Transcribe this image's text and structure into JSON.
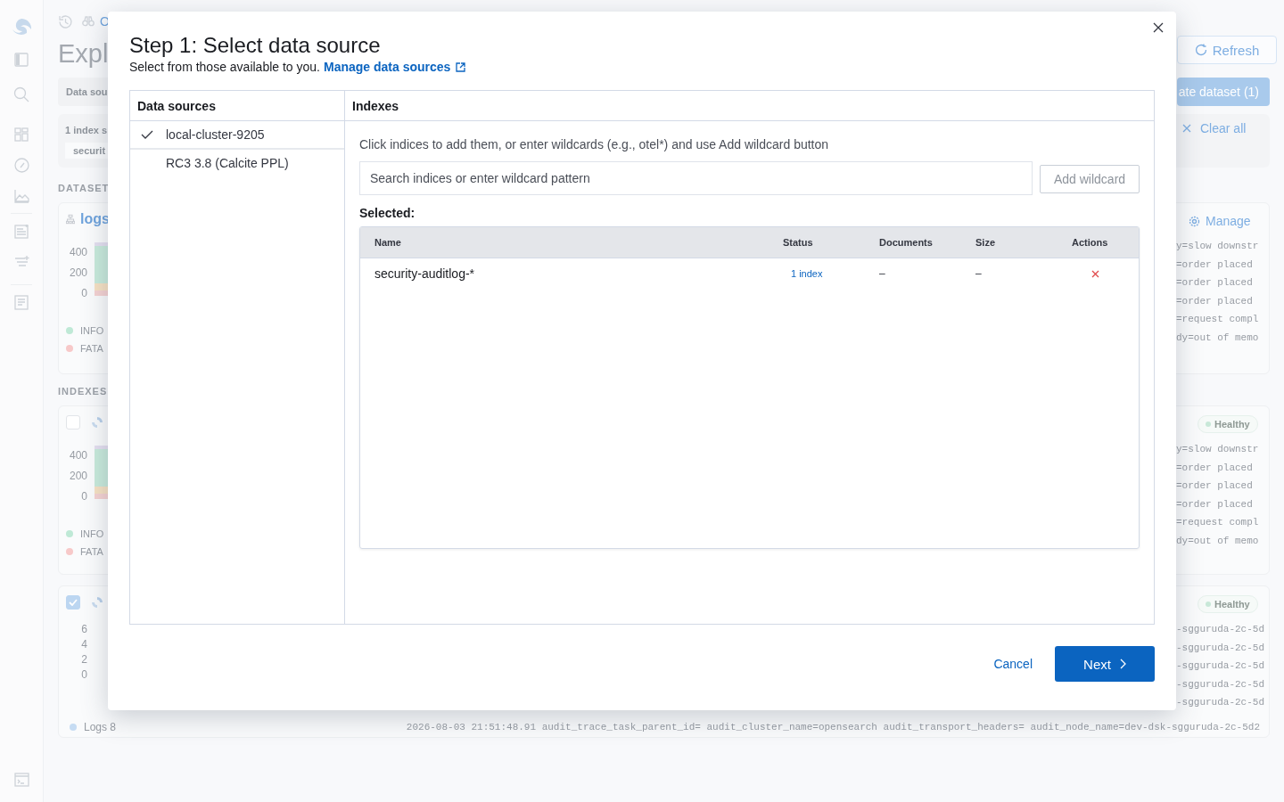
{
  "background": {
    "breadcrumb": "O",
    "page_title": "Expl",
    "refresh_button": "Refresh",
    "data_source_label": "Data sou",
    "create_button": "ate dataset (1)",
    "selection_summary": "1 index s",
    "selected_chip": "securit",
    "clear_button": "Clear all",
    "datasets_heading": "DATASET",
    "indexes_heading": "INDEXES",
    "cards": [
      {
        "kind": "dataset",
        "title": "logs",
        "action": "Manage",
        "y_ticks": [
          "400",
          "200",
          "0"
        ],
        "legend": [
          {
            "label": "INFO",
            "color": "#bfe9d6"
          },
          {
            "label": "FATA",
            "color": "#f7c9c9"
          }
        ],
        "log_lines": [
          "y=slow downstr",
          "=order placed",
          "=order placed",
          "=order placed",
          "=request compl",
          "dy=out of memo"
        ]
      },
      {
        "kind": "index",
        "checked": false,
        "status": "Healthy",
        "y_ticks": [
          "400",
          "200",
          "0"
        ],
        "legend": [
          {
            "label": "INFO",
            "color": "#bfe9d6"
          },
          {
            "label": "FATA",
            "color": "#f7c9c9"
          }
        ],
        "log_lines": [
          "y=slow downstr",
          "=order placed",
          "=order placed",
          "=order placed",
          "=request compl",
          "dy=out of memo"
        ]
      },
      {
        "kind": "index",
        "checked": true,
        "status": "Healthy",
        "y_ticks": [
          "6",
          "4",
          "2",
          "0"
        ],
        "legend": [
          {
            "label": "Logs 8",
            "color": "#c6dcf3"
          }
        ],
        "log_lines": [
          "-sgguruda-2c-5d",
          "-sgguruda-2c-5d",
          "-sgguruda-2c-5d",
          "-sgguruda-2c-5d",
          "-sgguruda-2c-5d"
        ],
        "footer_line": "2026-08-03 21:51:48.91 audit_trace_task_parent_id= audit_cluster_name=opensearch audit_transport_headers= audit_node_name=dev-dsk-sgguruda-2c-5d2"
      }
    ]
  },
  "modal": {
    "title": "Step 1: Select data source",
    "subtitle": "Select from those available to you.",
    "manage_link": "Manage data sources",
    "data_sources": {
      "heading": "Data sources",
      "items": [
        {
          "label": "local-cluster-9205",
          "selected": true
        },
        {
          "label": "RC3 3.8 (Calcite PPL)",
          "selected": false
        }
      ]
    },
    "indexes": {
      "heading": "Indexes",
      "hint": "Click indices to add them, or enter wildcards (e.g., otel*) and use Add wildcard button",
      "search": {
        "placeholder": "Search indices or enter wildcard pattern"
      },
      "add_button": "Add wildcard",
      "selected_label": "Selected:",
      "table": {
        "columns": [
          "Name",
          "Status",
          "Documents",
          "Size",
          "Actions"
        ],
        "rows": [
          {
            "name": "security-auditlog-*",
            "status": "1 index",
            "documents": "–",
            "size": "–"
          }
        ]
      }
    },
    "cancel_button": "Cancel",
    "next_button": "Next"
  }
}
